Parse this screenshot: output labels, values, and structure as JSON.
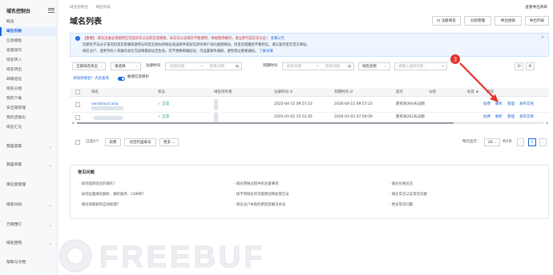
{
  "sidebar": {
    "title": "域名控制台",
    "items": [
      {
        "label": "概览"
      },
      {
        "label": "域名列表",
        "active": true
      },
      {
        "label": "信息模板"
      },
      {
        "label": "批量操作"
      },
      {
        "label": "域名转入"
      },
      {
        "label": "域名转出"
      },
      {
        "label": "邮箱验证"
      },
      {
        "label": "域名分组"
      },
      {
        "label": "我的下载"
      },
      {
        "label": "安全锁管理"
      },
      {
        "label": "我的店铺化"
      },
      {
        "label": "域名汇化"
      }
    ],
    "groups": [
      {
        "label": "我是卖家"
      },
      {
        "label": "我是买家"
      },
      {
        "label": "保证金管理"
      },
      {
        "label": "域名纠纷"
      },
      {
        "label": "万网预订"
      },
      {
        "label": "域名回购"
      },
      {
        "label": "帮助与文档"
      }
    ]
  },
  "breadcrumb": [
    "域名控制台",
    "域名列表"
  ],
  "top_right": "查看导出清单",
  "page_title": "域名列表",
  "toolbar": {
    "register": "注册域名",
    "group_manage": "分组管理",
    "import_search": "导出搜索",
    "export": "导出列表"
  },
  "notice": {
    "line1": "【重要】 域名注册必须使用已完成实名认证的信息模板，未实名认证域名不能使用，将被暂停解析，请立即完成实名认证！",
    "line1_link": "查看公告",
    "line2": "近期有不法分子冒充阿里云客服或使用与阿里云相似的网址发送邮件或短信诱导用户访问虚假网站，阿里云提醒您不要轻信，请认准阿里云官方网址。",
    "line3": "域名过户、变更持有人等操作会在完成邮箱验证后生效，若不想要邮箱验证，可设置邮件通知，避免错过重要通知。",
    "line3_link": "了解详情"
  },
  "filters": {
    "all_status": "全部域名状态",
    "select": "请选择",
    "reg_time_label": "注册时间",
    "start_date": "起始日期",
    "end_date": "结束日期",
    "expire_time_label": "到期时间",
    "domain_name_opt": "域名名称",
    "search_placeholder": "请输入搜索内容...",
    "no_anti_entry": "未找到域名？点此查询",
    "protect_label": "敏感信息保护"
  },
  "table": {
    "headers": [
      "域名",
      "状态",
      "域名持有者",
      "注册时间",
      "到期时间",
      "提示",
      "分组",
      "标签",
      "操作"
    ],
    "rows": [
      {
        "domain": "sendcloud.asia",
        "status": "正常",
        "reg": "2025-04-15 09:57:23",
        "exp": "2026-04-15 09:57:23",
        "tip": "距有效364天过期",
        "actions": [
          "续费",
          "解析",
          "管理",
          "发布交易"
        ]
      },
      {
        "domain": "",
        "status": "正常",
        "reg": "2025-01-02 15:52:45",
        "exp": "2026-01-03 07:59:59",
        "tip": "距有效262天过期",
        "actions": [
          "续费",
          "解析",
          "管理",
          "发布交易"
        ]
      }
    ]
  },
  "footer": {
    "selected": "已选0个",
    "renew": "续费",
    "push_same": "同至阿里账号",
    "more": "更多",
    "per_page_label": "每页显示：",
    "per_page_value": "20",
    "total": "共2条",
    "page": "1"
  },
  "faq": {
    "title": "常见问题",
    "items": [
      "如何选择适合的域名？",
      "如何设置域名解析、解析服务、CDN等？",
      "域名续期如何自动续期？",
      "域名转账过程中的注意事项",
      "找不到域名的可能原因和处理方法",
      "域名过户失败的原因及解决办法",
      "域名价格总览",
      "域名实名认证常见问题",
      "更多常见问题"
    ]
  },
  "annotation": "3",
  "watermark": "FREEBUF",
  "colors": {
    "accent": "#1a66d8",
    "danger": "#d0312d",
    "arrow": "#e8312a",
    "ok": "#20a35a"
  }
}
